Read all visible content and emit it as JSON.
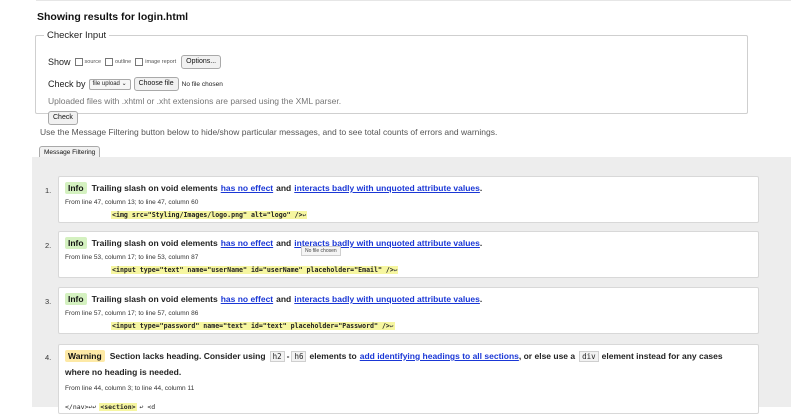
{
  "page": {
    "heading": "Showing results for login.html"
  },
  "checker": {
    "legend": "Checker Input",
    "show_label": "Show",
    "options": [
      "source",
      "outline",
      "image report"
    ],
    "options_button": "Options...",
    "checkby_label": "Check by",
    "checkby_select": "file upload",
    "choose_file_button": "Choose file",
    "no_file_text": "No file chosen",
    "note": "Uploaded files with .xhtml or .xht extensions are parsed using the XML parser.",
    "check_button": "Check"
  },
  "filtering": {
    "note": "Use the Message Filtering button below to hide/show particular messages, and to see total counts of errors and warnings.",
    "button": "Message Filtering"
  },
  "tooltip": "No file chosen",
  "messages": [
    {
      "num": "1.",
      "type": "Info",
      "text_pre": "Trailing slash on void elements",
      "link1": "has no effect",
      "mid": "and",
      "link2": "interacts badly with unquoted attribute values",
      "end": ".",
      "location": "From line 47, column 13; to line 47, column 60",
      "code": "<img src=\"Styling/Images/logo.png\" alt=\"logo\" />",
      "code_tail": "↩"
    },
    {
      "num": "2.",
      "type": "Info",
      "text_pre": "Trailing slash on void elements",
      "link1": "has no effect",
      "mid": "and",
      "link2": "interacts badly with unquoted attribute values",
      "end": ".",
      "location": "From line 53, column 17; to line 53, column 87",
      "code": "<input type=\"text\" name=\"userName\" id=\"userName\" placeholder=\"Email\" />",
      "code_tail": "↩"
    },
    {
      "num": "3.",
      "type": "Info",
      "text_pre": "Trailing slash on void elements",
      "link1": "has no effect",
      "mid": "and",
      "link2": "interacts badly with unquoted attribute values",
      "end": ".",
      "location": "From line 57, column 17; to line 57, column 86",
      "code": "<input type=\"password\" name=\"text\" id=\"text\" placeholder=\"Password\" />",
      "code_tail": "↩"
    },
    {
      "num": "4.",
      "type": "Warning",
      "text_pre": "Section lacks heading. Consider using",
      "code_a": "h2",
      "dash": "-",
      "code_b": "h6",
      "text_mid": "elements to",
      "link1": "add identifying headings to all sections",
      "text_post": ", or else use a",
      "code_c": "div",
      "text_end": "element instead for any cases",
      "line2": "where no heading is needed.",
      "location": "From line 44, column 3; to line 44, column 11",
      "code_pre": "</nav>↩↩",
      "code": "<section>",
      "code_post": "↩    <d"
    }
  ],
  "icons": {
    "select_arrow": "chevron-down-icon"
  }
}
